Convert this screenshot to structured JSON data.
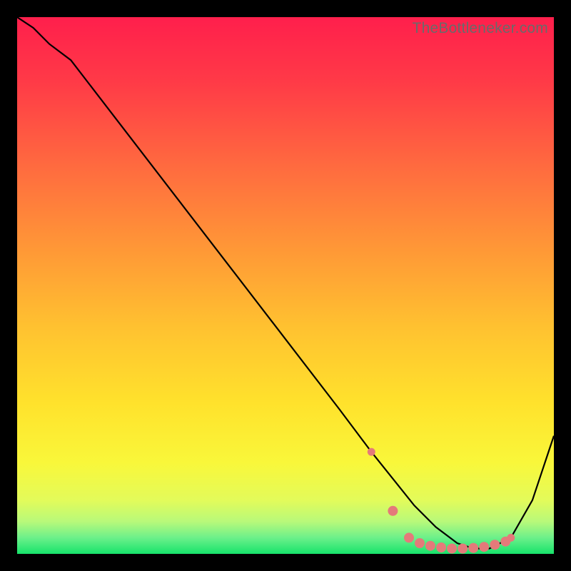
{
  "watermark": "TheBottleneker.com",
  "colors": {
    "bg": "#000000",
    "curve": "#000000",
    "markers": "#e47a7a",
    "green": "#17e36b"
  },
  "chart_data": {
    "type": "line",
    "title": "",
    "xlabel": "",
    "ylabel": "",
    "xlim": [
      0,
      100
    ],
    "ylim": [
      0,
      100
    ],
    "grid": false,
    "legend": false,
    "series": [
      {
        "name": "bottleneck-curve",
        "x": [
          0,
          3,
          6,
          10,
          20,
          30,
          40,
          50,
          60,
          66,
          70,
          74,
          78,
          82,
          85,
          88,
          92,
          96,
          100
        ],
        "y": [
          100,
          98,
          95,
          92,
          79,
          66,
          53,
          40,
          27,
          19,
          14,
          9,
          5,
          2,
          1,
          1,
          3,
          10,
          22
        ]
      }
    ],
    "markers": {
      "name": "optimal-points",
      "x": [
        66,
        70,
        73,
        75,
        77,
        79,
        81,
        83,
        85,
        87,
        89,
        91,
        92
      ],
      "y": [
        19,
        8,
        3,
        2,
        1.5,
        1.2,
        1,
        1,
        1.1,
        1.3,
        1.7,
        2.3,
        3
      ]
    },
    "gradient_stops": [
      {
        "offset": 0.0,
        "color": "#ff1f4c"
      },
      {
        "offset": 0.12,
        "color": "#ff3a47"
      },
      {
        "offset": 0.28,
        "color": "#ff6b3f"
      },
      {
        "offset": 0.44,
        "color": "#ff9a36"
      },
      {
        "offset": 0.58,
        "color": "#ffc230"
      },
      {
        "offset": 0.72,
        "color": "#ffe22c"
      },
      {
        "offset": 0.83,
        "color": "#f9f73a"
      },
      {
        "offset": 0.9,
        "color": "#e3fb5a"
      },
      {
        "offset": 0.94,
        "color": "#b8f97a"
      },
      {
        "offset": 0.97,
        "color": "#6cf08a"
      },
      {
        "offset": 1.0,
        "color": "#17e36b"
      }
    ]
  }
}
